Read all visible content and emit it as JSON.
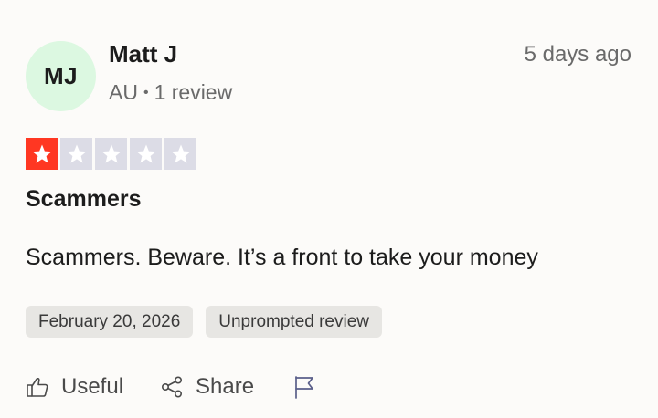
{
  "review": {
    "avatar_initials": "MJ",
    "avatar_color": "#dcf8e1",
    "author_name": "Matt J",
    "country": "AU",
    "separator": "•",
    "review_count": "1 review",
    "posted_ago": "5 days ago",
    "rating": 1,
    "rating_max": 5,
    "star_colors": {
      "filled": "#ff3722",
      "empty": "#dcdce6"
    },
    "title": "Scammers",
    "body": "Scammers. Beware. It’s a front to take your money",
    "tags": [
      {
        "label": "February 20, 2026"
      },
      {
        "label": "Unprompted review"
      }
    ],
    "actions": {
      "useful_label": "Useful",
      "share_label": "Share"
    },
    "icons": {
      "useful": "thumbs-up-icon",
      "share": "share-icon",
      "flag": "flag-icon"
    }
  }
}
